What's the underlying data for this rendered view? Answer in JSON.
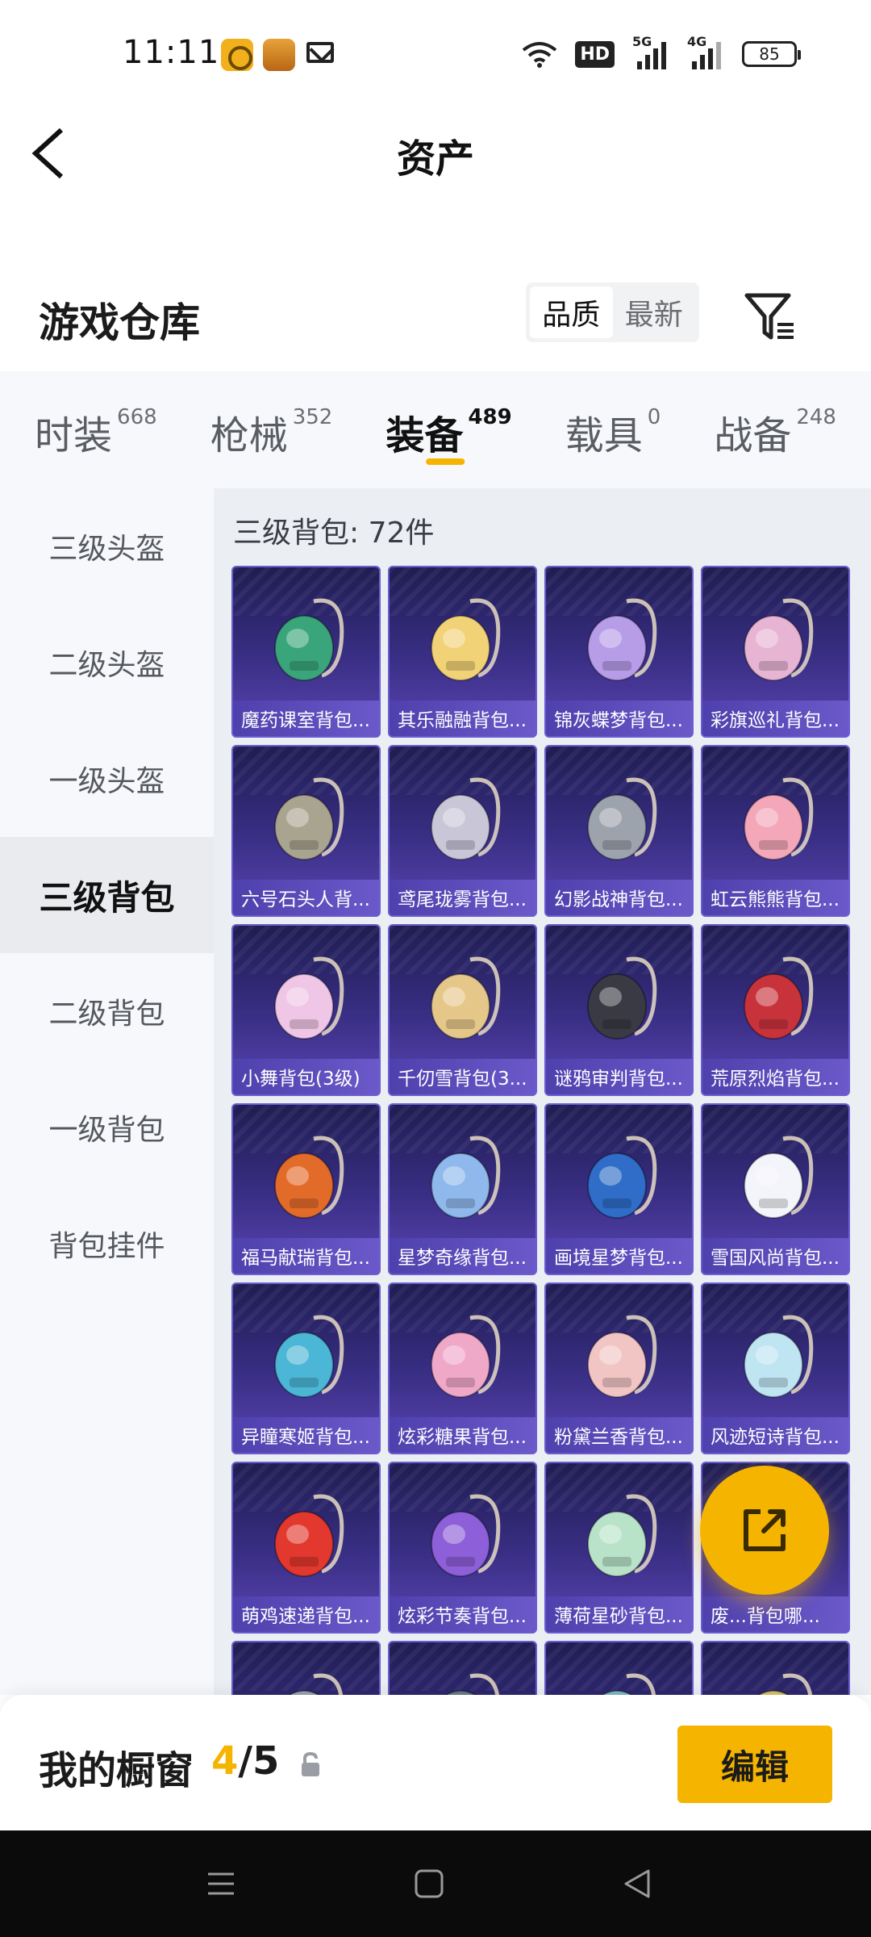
{
  "status_bar": {
    "time": "11:11",
    "hd": "HD",
    "sig1": "5G",
    "sig2": "4G",
    "battery": "85"
  },
  "header": {
    "title": "资产"
  },
  "warehouse": {
    "title": "游戏仓库",
    "sort_options": [
      "品质",
      "最新"
    ],
    "active_sort": "品质"
  },
  "categories": [
    {
      "label": "时装",
      "count": "668"
    },
    {
      "label": "枪械",
      "count": "352"
    },
    {
      "label": "装备",
      "count": "489",
      "active": true
    },
    {
      "label": "载具",
      "count": "0"
    },
    {
      "label": "战备",
      "count": "248"
    }
  ],
  "sidebar": {
    "items": [
      "三级头盔",
      "二级头盔",
      "一级头盔",
      "三级背包",
      "二级背包",
      "一级背包",
      "背包挂件"
    ],
    "active_index": 3
  },
  "main": {
    "heading": "三级背包: 72件",
    "items": [
      {
        "name": "魔药课室背包...",
        "color": "#3aa57a"
      },
      {
        "name": "其乐融融背包...",
        "color": "#f2d277"
      },
      {
        "name": "锦灰蝶梦背包...",
        "color": "#b79ce8"
      },
      {
        "name": "彩旗巡礼背包...",
        "color": "#e7b4d4"
      },
      {
        "name": "六号石头人背...",
        "color": "#a9a48f"
      },
      {
        "name": "鸢尾珑雾背包...",
        "color": "#c9c6d8"
      },
      {
        "name": "幻影战神背包...",
        "color": "#9da3ad"
      },
      {
        "name": "虹云熊熊背包...",
        "color": "#f3a7b8"
      },
      {
        "name": "小舞背包(3级)",
        "color": "#f0c6e6"
      },
      {
        "name": "千仞雪背包(3...",
        "color": "#e6c78a"
      },
      {
        "name": "谜鸦审判背包...",
        "color": "#3a3a44"
      },
      {
        "name": "荒原烈焰背包...",
        "color": "#c8333b"
      },
      {
        "name": "福马献瑞背包...",
        "color": "#e36b2a"
      },
      {
        "name": "星梦奇缘背包...",
        "color": "#8fb8ec"
      },
      {
        "name": "画境星梦背包...",
        "color": "#2f6dc8"
      },
      {
        "name": "雪国风尚背包...",
        "color": "#f4f4fb"
      },
      {
        "name": "异瞳寒姬背包...",
        "color": "#4cb6d6"
      },
      {
        "name": "炫彩糖果背包...",
        "color": "#f0a8c8"
      },
      {
        "name": "粉黛兰香背包...",
        "color": "#f2c5c5"
      },
      {
        "name": "风迹短诗背包...",
        "color": "#bfe4f2"
      },
      {
        "name": "萌鸡速递背包...",
        "color": "#e2382e"
      },
      {
        "name": "炫彩节奏背包...",
        "color": "#8d5fd8"
      },
      {
        "name": "薄荷星砂背包...",
        "color": "#b9e3c8"
      },
      {
        "name": "废...背包哪...",
        "color": "#e7b46a"
      },
      {
        "name": "",
        "color": "#9aa3b2"
      },
      {
        "name": "",
        "color": "#6b7d88"
      },
      {
        "name": "",
        "color": "#7fb8c8"
      },
      {
        "name": "",
        "color": "#d9c06a"
      }
    ]
  },
  "bottom_bar": {
    "title": "我的橱窗",
    "current": "4",
    "total": "/5",
    "edit_label": "编辑"
  }
}
